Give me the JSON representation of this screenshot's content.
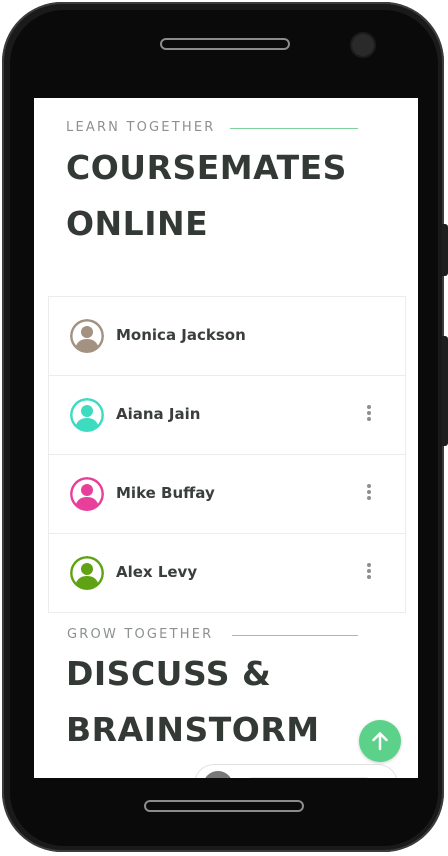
{
  "section_courses": {
    "eyebrow": "LEARN TOGETHER",
    "title_line1": "COURSEMATES",
    "title_line2": "ONLINE"
  },
  "coursemates": [
    {
      "name": "Monica Jackson",
      "avatar_color": "#a39181",
      "avatar_icon": "user-avatar-icon",
      "has_menu": false
    },
    {
      "name": "Aiana Jain",
      "avatar_color": "#3ddcc0",
      "avatar_icon": "user-avatar-icon",
      "has_menu": true
    },
    {
      "name": "Mike Buffay",
      "avatar_color": "#e8409a",
      "avatar_icon": "user-avatar-icon",
      "has_menu": true
    },
    {
      "name": "Alex Levy",
      "avatar_color": "#5fa315",
      "avatar_icon": "user-avatar-icon",
      "has_menu": true
    }
  ],
  "section_discuss": {
    "eyebrow": "GROW TOGETHER",
    "title_line1": "DISCUSS &",
    "title_line2": "BRAINSTORM"
  },
  "scroll_top": {
    "icon": "arrow-up-icon"
  },
  "colors": {
    "accent": "#5cd189",
    "heading": "#333a35",
    "eyebrow": "#8c918f",
    "divider": "#7fd39a"
  }
}
